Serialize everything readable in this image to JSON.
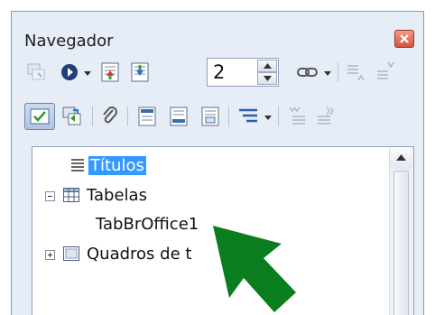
{
  "window": {
    "title": "Navegador"
  },
  "toolbar": {
    "page_number": "2"
  },
  "tree": {
    "items": [
      {
        "label": "Títulos",
        "selected": true
      },
      {
        "label": "Tabelas",
        "expanded": true
      },
      {
        "label": "TabBrOffice1"
      },
      {
        "label": "Quadros de t",
        "expanded": false
      }
    ]
  },
  "colors": {
    "selection": "#3399ff",
    "arrow": "#0a7d1e",
    "panel_bg": "#e6edf7"
  },
  "icons": {
    "close": "close-icon",
    "callout": "green-arrow-icon"
  }
}
